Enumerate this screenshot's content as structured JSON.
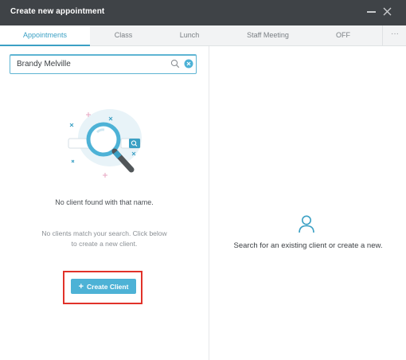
{
  "window": {
    "title": "Create new appointment"
  },
  "tabs": [
    {
      "label": "Appointments",
      "active": true
    },
    {
      "label": "Class",
      "active": false
    },
    {
      "label": "Lunch",
      "active": false
    },
    {
      "label": "Staff Meeting",
      "active": false
    },
    {
      "label": "OFF",
      "active": false
    }
  ],
  "tabs_more": "···",
  "search": {
    "value": "Brandy Melville",
    "placeholder": ""
  },
  "left_panel": {
    "not_found_text": "No client found with that name.",
    "no_match_text": "No clients match your search. Click below to create a new client.",
    "create_button": {
      "icon": "plus-icon",
      "label": "Create Client"
    }
  },
  "right_panel": {
    "icon": "person-icon",
    "message": "Search for an existing client or create a new."
  },
  "colors": {
    "titlebar": "#3f4347",
    "accent": "#3ba0c4",
    "button": "#4db2d6",
    "highlight": "#e1322a"
  }
}
